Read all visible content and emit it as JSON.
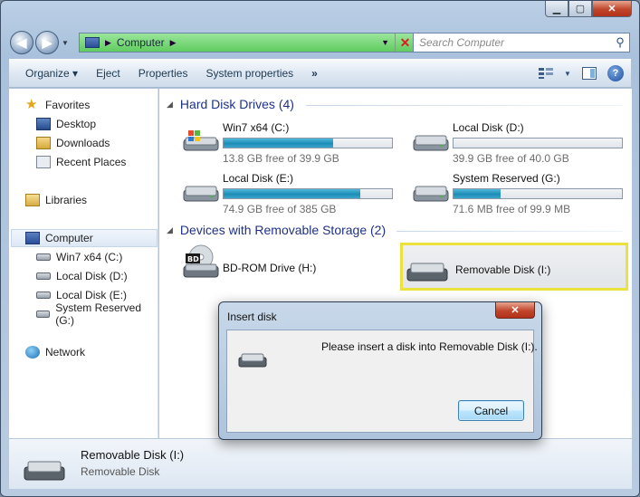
{
  "window": {
    "caption": {
      "minimize": "▁",
      "maximize": "▢",
      "close": "✕"
    }
  },
  "address_bar": {
    "location": "Computer",
    "search_placeholder": "Search Computer"
  },
  "toolbar": {
    "items": [
      "Organize",
      "Eject",
      "Properties",
      "System properties"
    ],
    "organize_arrow": "▾",
    "more": "»"
  },
  "nav_pane": {
    "favorites": {
      "label": "Favorites",
      "items": [
        "Desktop",
        "Downloads",
        "Recent Places"
      ]
    },
    "libraries": "Libraries",
    "computer": {
      "label": "Computer",
      "items": [
        "Win7 x64 (C:)",
        "Local Disk (D:)",
        "Local Disk (E:)",
        "System Reserved (G:)"
      ]
    },
    "network": "Network"
  },
  "content": {
    "hard_disk_header": "Hard Disk Drives (4)",
    "removable_header": "Devices with Removable Storage (2)",
    "drives": [
      {
        "name": "Win7 x64 (C:)",
        "free": "13.8 GB free of 39.9 GB",
        "used_fraction": 0.65
      },
      {
        "name": "Local Disk (D:)",
        "free": "39.9 GB free of 40.0 GB",
        "used_fraction": 0.0
      },
      {
        "name": "Local Disk (E:)",
        "free": "74.9 GB free of 385 GB",
        "used_fraction": 0.81
      },
      {
        "name": "System Reserved (G:)",
        "free": "71.6 MB free of 99.9 MB",
        "used_fraction": 0.28
      }
    ],
    "removable": [
      {
        "name": "BD-ROM Drive (H:)",
        "badge": "BD"
      },
      {
        "name": "Removable Disk (I:)"
      }
    ]
  },
  "details": {
    "name": "Removable Disk (I:)",
    "type": "Removable Disk"
  },
  "dialog": {
    "title": "Insert disk",
    "message": "Please insert a disk into Removable Disk (I:).",
    "cancel": "Cancel",
    "close": "✕"
  },
  "colors": {
    "bar_fill": "#1d8cb6",
    "address_bg": "#60cc60",
    "highlight_border": "#ece23e",
    "section_text": "#1e3287"
  }
}
